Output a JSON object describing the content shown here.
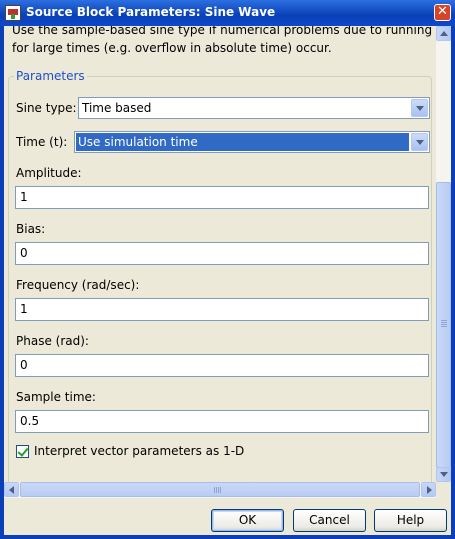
{
  "window": {
    "title": "Source Block Parameters: Sine Wave",
    "close_glyph": "✕"
  },
  "description": "Use the sample-based sine type if numerical problems due to running for large times (e.g. overflow in absolute time) occur.",
  "parameters": {
    "group_title": "Parameters",
    "sine_type": {
      "label": "Sine type:",
      "value": "Time based"
    },
    "time": {
      "label": "Time (t):",
      "value": "Use simulation time"
    },
    "amplitude": {
      "label": "Amplitude:",
      "value": "1"
    },
    "bias": {
      "label": "Bias:",
      "value": "0"
    },
    "frequency": {
      "label": "Frequency (rad/sec):",
      "value": "1"
    },
    "phase": {
      "label": "Phase (rad):",
      "value": "0"
    },
    "sample_time": {
      "label": "Sample time:",
      "value": "0.5"
    },
    "interpret_vector": {
      "label": "Interpret vector parameters as 1-D",
      "checked": true
    }
  },
  "buttons": {
    "ok": "OK",
    "cancel": "Cancel",
    "help": "Help"
  },
  "colors": {
    "titlebar": "#0a3fb8",
    "selection": "#316ac5",
    "group_title": "#2150c8",
    "checkmark": "#21a121"
  }
}
